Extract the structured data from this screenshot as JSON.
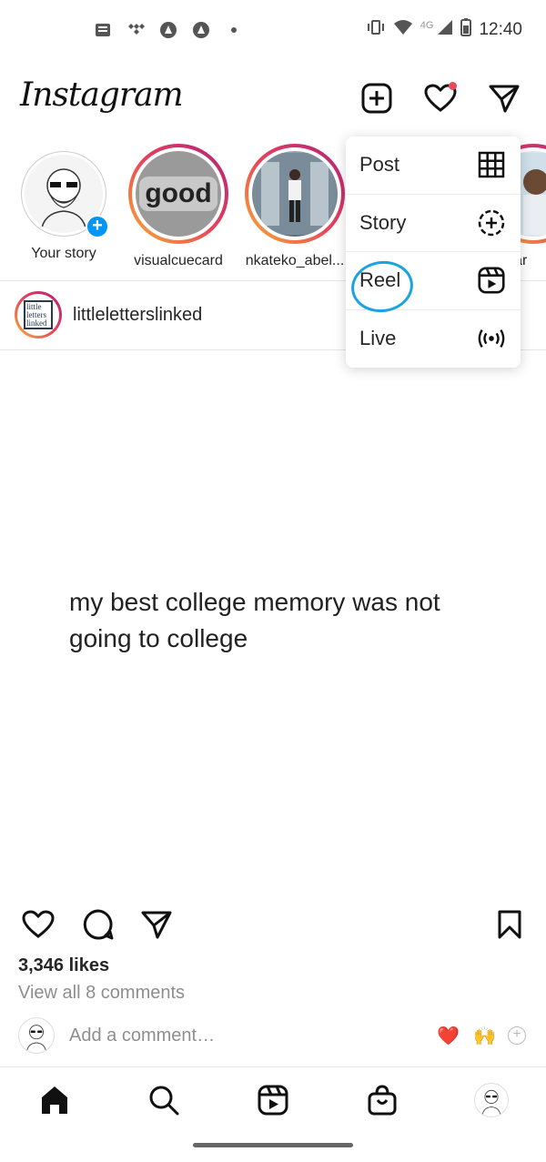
{
  "status_bar": {
    "network": "4G",
    "time": "12:40",
    "icons": [
      "message-icon",
      "tidal-icon",
      "app-icon",
      "app-icon",
      "dot-icon",
      "vibrate-icon",
      "wifi-icon",
      "signal-icon",
      "battery-icon"
    ]
  },
  "header": {
    "logo": "Instagram",
    "icons": [
      "new-post-icon",
      "heart-icon",
      "direct-message-icon"
    ],
    "notification_dot_color": "#ed4956"
  },
  "stories": [
    {
      "label": "Your story"
    },
    {
      "label": "visualcuecard",
      "avatar_text": "good"
    },
    {
      "label": "nkateko_abel..."
    },
    {
      "label": "s.ar"
    }
  ],
  "create_menu": {
    "items": [
      {
        "label": "Post",
        "icon": "grid-icon"
      },
      {
        "label": "Story",
        "icon": "story-plus-icon"
      },
      {
        "label": "Reel",
        "icon": "reel-icon"
      },
      {
        "label": "Live",
        "icon": "live-icon"
      }
    ],
    "highlight_color": "#1aa3e0"
  },
  "post": {
    "username": "littleletterslinked",
    "avatar_text": [
      "little",
      "letters",
      "linked"
    ],
    "text": "my best college memory was not going to college",
    "likes": "3,346 likes",
    "view_comments": "View all 8 comments",
    "comment_placeholder": "Add a comment…",
    "quick_emojis": [
      "❤️",
      "🙌"
    ]
  },
  "bottom_nav": [
    "home-icon",
    "search-icon",
    "reels-icon",
    "shop-icon",
    "profile-avatar"
  ],
  "colors": {
    "accent": "#0095f6",
    "story_ring_start": "#f9b233",
    "story_ring_end": "#b0227a"
  }
}
